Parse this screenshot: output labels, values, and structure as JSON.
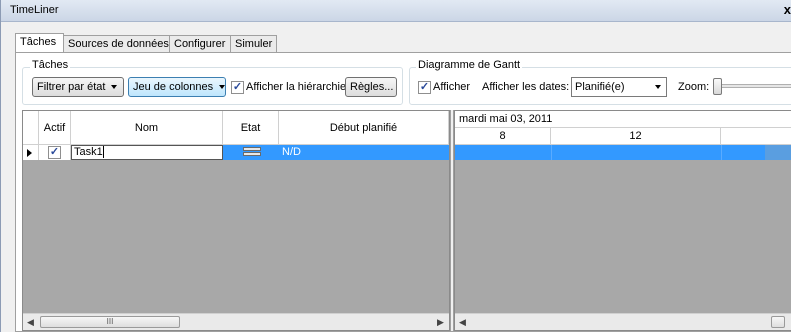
{
  "window": {
    "title": "TimeLiner",
    "close_glyph": "x"
  },
  "tabs": [
    "Tâches",
    "Sources de données",
    "Configurer",
    "Simuler"
  ],
  "tasks_group": {
    "label": "Tâches",
    "filter_button": "Filtrer par état",
    "columns_button": "Jeu de colonnes",
    "show_hierarchy_label": "Afficher la hiérarchie",
    "show_hierarchy_checked": true,
    "rules_button": "Règles..."
  },
  "gantt_group": {
    "label": "Diagramme de Gantt",
    "show_label": "Afficher",
    "show_checked": true,
    "show_dates_label": "Afficher les dates:",
    "show_dates_value": "Planifié(e)",
    "zoom_label": "Zoom:"
  },
  "table": {
    "columns": [
      "Actif",
      "Nom",
      "Etat",
      "Début planifié"
    ],
    "rows": [
      {
        "active": true,
        "name": "Task1",
        "state_icon": "state-bar-icon",
        "planned_start": "N/D"
      }
    ]
  },
  "gantt": {
    "date_header": "mardi mai 03, 2011",
    "hours": [
      "8",
      "12"
    ]
  },
  "scrollbar": {
    "thumb_grip": "III"
  },
  "colors": {
    "selection": "#3399ff",
    "empty_area": "#a8a8a8"
  }
}
